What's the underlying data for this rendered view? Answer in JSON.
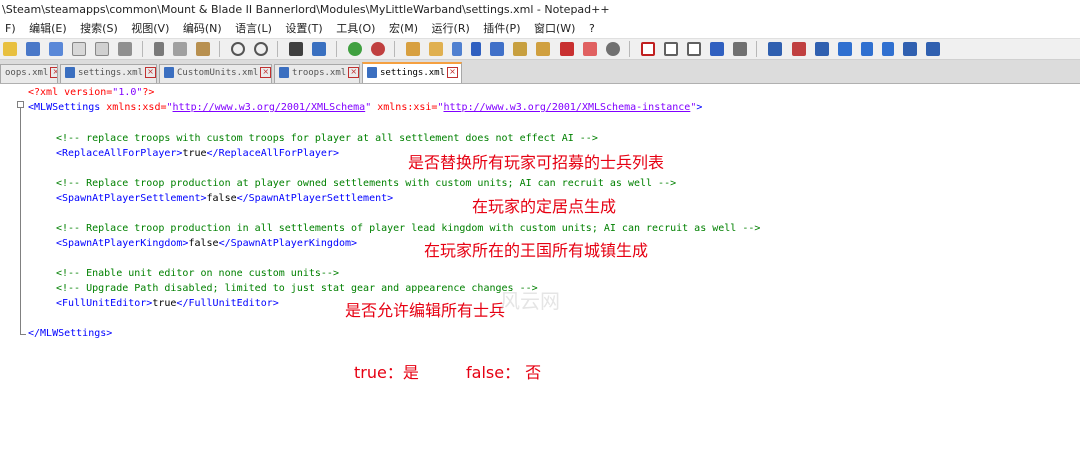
{
  "window": {
    "title": "\\Steam\\steamapps\\common\\Mount & Blade II Bannerlord\\Modules\\MyLittleWarband\\settings.xml - Notepad++"
  },
  "menu": [
    "F)",
    "编辑(E)",
    "搜索(S)",
    "视图(V)",
    "编码(N)",
    "语言(L)",
    "设置(T)",
    "工具(O)",
    "宏(M)",
    "运行(R)",
    "插件(P)",
    "窗口(W)",
    "?"
  ],
  "tabs": [
    {
      "label": "oops.xml",
      "active": false
    },
    {
      "label": "settings.xml",
      "active": false
    },
    {
      "label": "CustomUnits.xml",
      "active": false
    },
    {
      "label": "troops.xml",
      "active": false
    },
    {
      "label": "settings.xml",
      "active": true
    }
  ],
  "code": {
    "decl": {
      "open": "<?xml version=",
      "ver": "\"1.0\"",
      "close": "?>"
    },
    "root_open": {
      "lt": "<",
      "tag": "MLWSettings",
      "a1": " xmlns:xsd=",
      "q1": "\"",
      "u1": "http://www.w3.org/2001/XMLSchema",
      "q1e": "\"",
      "a2": " xmlns:xsi=",
      "q2": "\"",
      "u2": "http://www.w3.org/2001/XMLSchema-instance",
      "q2e": "\"",
      "gt": ">"
    },
    "c1": "<!-- replace troops with custom troops for player at all settlement does not effect AI -->",
    "e1": {
      "open": "<ReplaceAllForPlayer>",
      "val": "true",
      "close": "</ReplaceAllForPlayer>"
    },
    "c2": "<!-- Replace troop production at player owned settlements with custom units; AI can recruit as well -->",
    "e2": {
      "open": "<SpawnAtPlayerSettlement>",
      "val": "false",
      "close": "</SpawnAtPlayerSettlement>"
    },
    "c3": "<!-- Replace troop production in all settlements of player lead kingdom with custom units; AI can recruit as well -->",
    "e3": {
      "open": "<SpawnAtPlayerKingdom>",
      "val": "false",
      "close": "</SpawnAtPlayerKingdom>"
    },
    "c4": "<!-- Enable unit editor on none custom units-->",
    "c5": "<!-- Upgrade Path disabled; limited to just stat gear and appearence changes -->",
    "e4": {
      "open": "<FullUnitEditor>",
      "val": "true",
      "close": "</FullUnitEditor>"
    },
    "root_close": "</MLWSettings>"
  },
  "annotations": {
    "replace_all": "是否替换所有玩家可招募的士兵列表",
    "spawn_settlement": "在玩家的定居点生成",
    "spawn_kingdom": "在玩家所在的王国所有城镇生成",
    "full_editor": "是否允许编辑所有士兵",
    "true_label": "true：是",
    "false_label": "false：  否"
  },
  "watermark": "风云网",
  "colors": {
    "annotation": "#e60012",
    "comment": "#008000",
    "tag": "#0000ff",
    "attr": "#ff0000",
    "string": "#8000ff"
  }
}
